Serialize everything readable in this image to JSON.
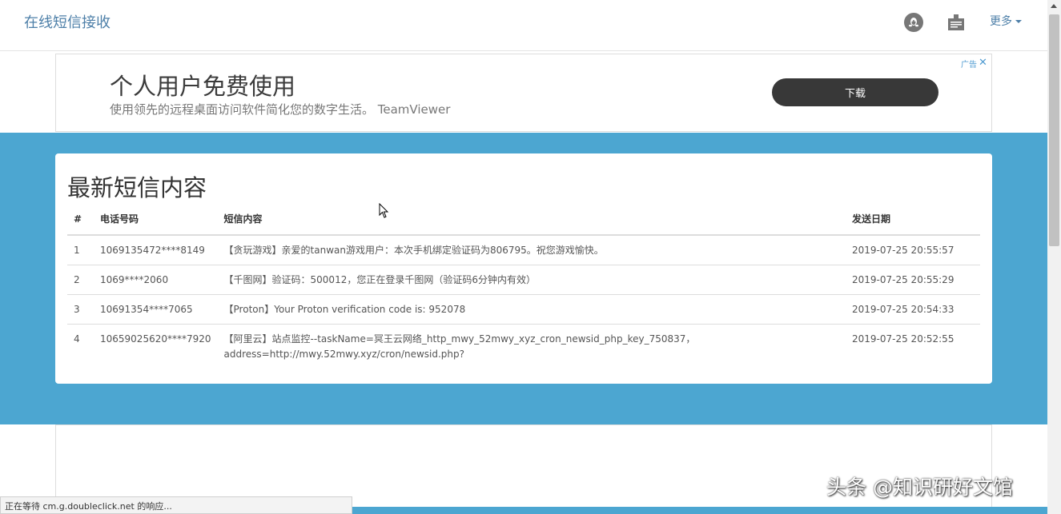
{
  "navbar": {
    "brand": "在线短信接收",
    "qq_icon": "qq-icon",
    "doc_icon": "document-icon",
    "more_label": "更多"
  },
  "ad_top": {
    "title": "个人用户免费使用",
    "subtitle": "使用领先的远程桌面访问软件简化您的数字生活。 TeamViewer",
    "download_label": "下载",
    "ad_tag": "广告",
    "close_icon": "close-icon"
  },
  "sms": {
    "title": "最新短信内容",
    "headers": [
      "#",
      "电话号码",
      "短信内容",
      "发送日期"
    ],
    "rows": [
      {
        "idx": "1",
        "phone": "1069135472****8149",
        "content": "【贪玩游戏】亲爱的tanwan游戏用户：本次手机绑定验证码为806795。祝您游戏愉快。",
        "date": "2019-07-25 20:55:57"
      },
      {
        "idx": "2",
        "phone": "1069****2060",
        "content": "【千图网】验证码：500012，您正在登录千图网（验证码6分钟内有效）",
        "date": "2019-07-25 20:55:29"
      },
      {
        "idx": "3",
        "phone": "10691354****7065",
        "content": "【Proton】Your Proton verification code is: 952078",
        "date": "2019-07-25 20:54:33"
      },
      {
        "idx": "4",
        "phone": "10659025620****7920",
        "content": "【阿里云】站点监控--taskName=冥王云网络_http_mwy_52mwy_xyz_cron_newsid_php_key_750837，address=http://mwy.52mwy.xyz/cron/newsid.php?",
        "date": "2019-07-25 20:52:55"
      }
    ]
  },
  "status_bar": "正在等待 cm.g.doubleclick.net 的响应...",
  "watermark": "头条 @知识研好文馆",
  "colors": {
    "band_blue": "#4ca6d1",
    "brand_blue": "#4d7fa8",
    "download_button": "#383838"
  }
}
